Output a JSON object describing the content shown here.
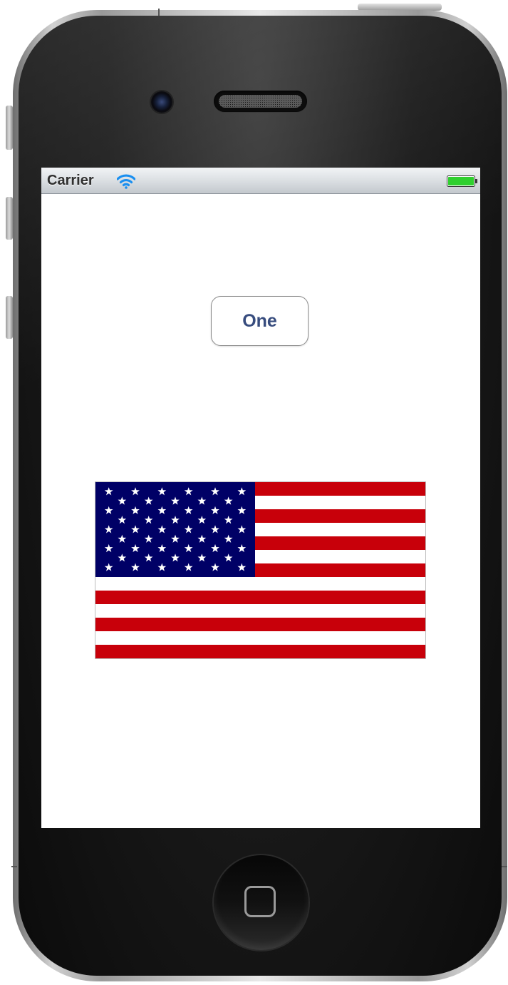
{
  "statusbar": {
    "carrier": "Carrier",
    "wifi_icon": "wifi-icon",
    "battery_icon": "battery-icon",
    "battery_level": 1.0,
    "battery_color": "#2fd02f"
  },
  "main": {
    "button_label": "One",
    "image_icon": "us-flag-image"
  },
  "device": {
    "home_icon": "home-button-icon",
    "accent_button_text_color": "#374c7e",
    "flag_red": "#c8000a",
    "flag_blue": "#000066"
  }
}
